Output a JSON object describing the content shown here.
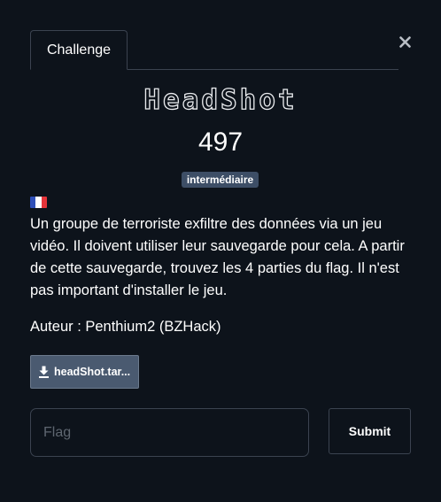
{
  "tabs": [
    {
      "label": "Challenge"
    }
  ],
  "close_icon": "close-icon",
  "challenge": {
    "name": "HeadShot",
    "points": "497",
    "difficulty": "intermédiaire",
    "language_flag": "france-flag-icon",
    "description": "Un groupe de terroriste exfiltre des données via un jeu vidéo. Il doivent utiliser leur sauvegarde pour cela. A partir de cette sauvegarde, trouvez les 4 parties du flag. Il n'est pas important d'installer le jeu.",
    "author": "Auteur : Penthium2 (BZHack)"
  },
  "files": [
    {
      "label": "headShot.tar...",
      "icon": "download-icon"
    }
  ],
  "submission": {
    "placeholder": "Flag",
    "value": "",
    "submit_label": "Submit"
  },
  "colors": {
    "background": "#0d131b",
    "badge": "#3d4e66",
    "file_button": "#4a5a70",
    "border": "#3b4350"
  }
}
